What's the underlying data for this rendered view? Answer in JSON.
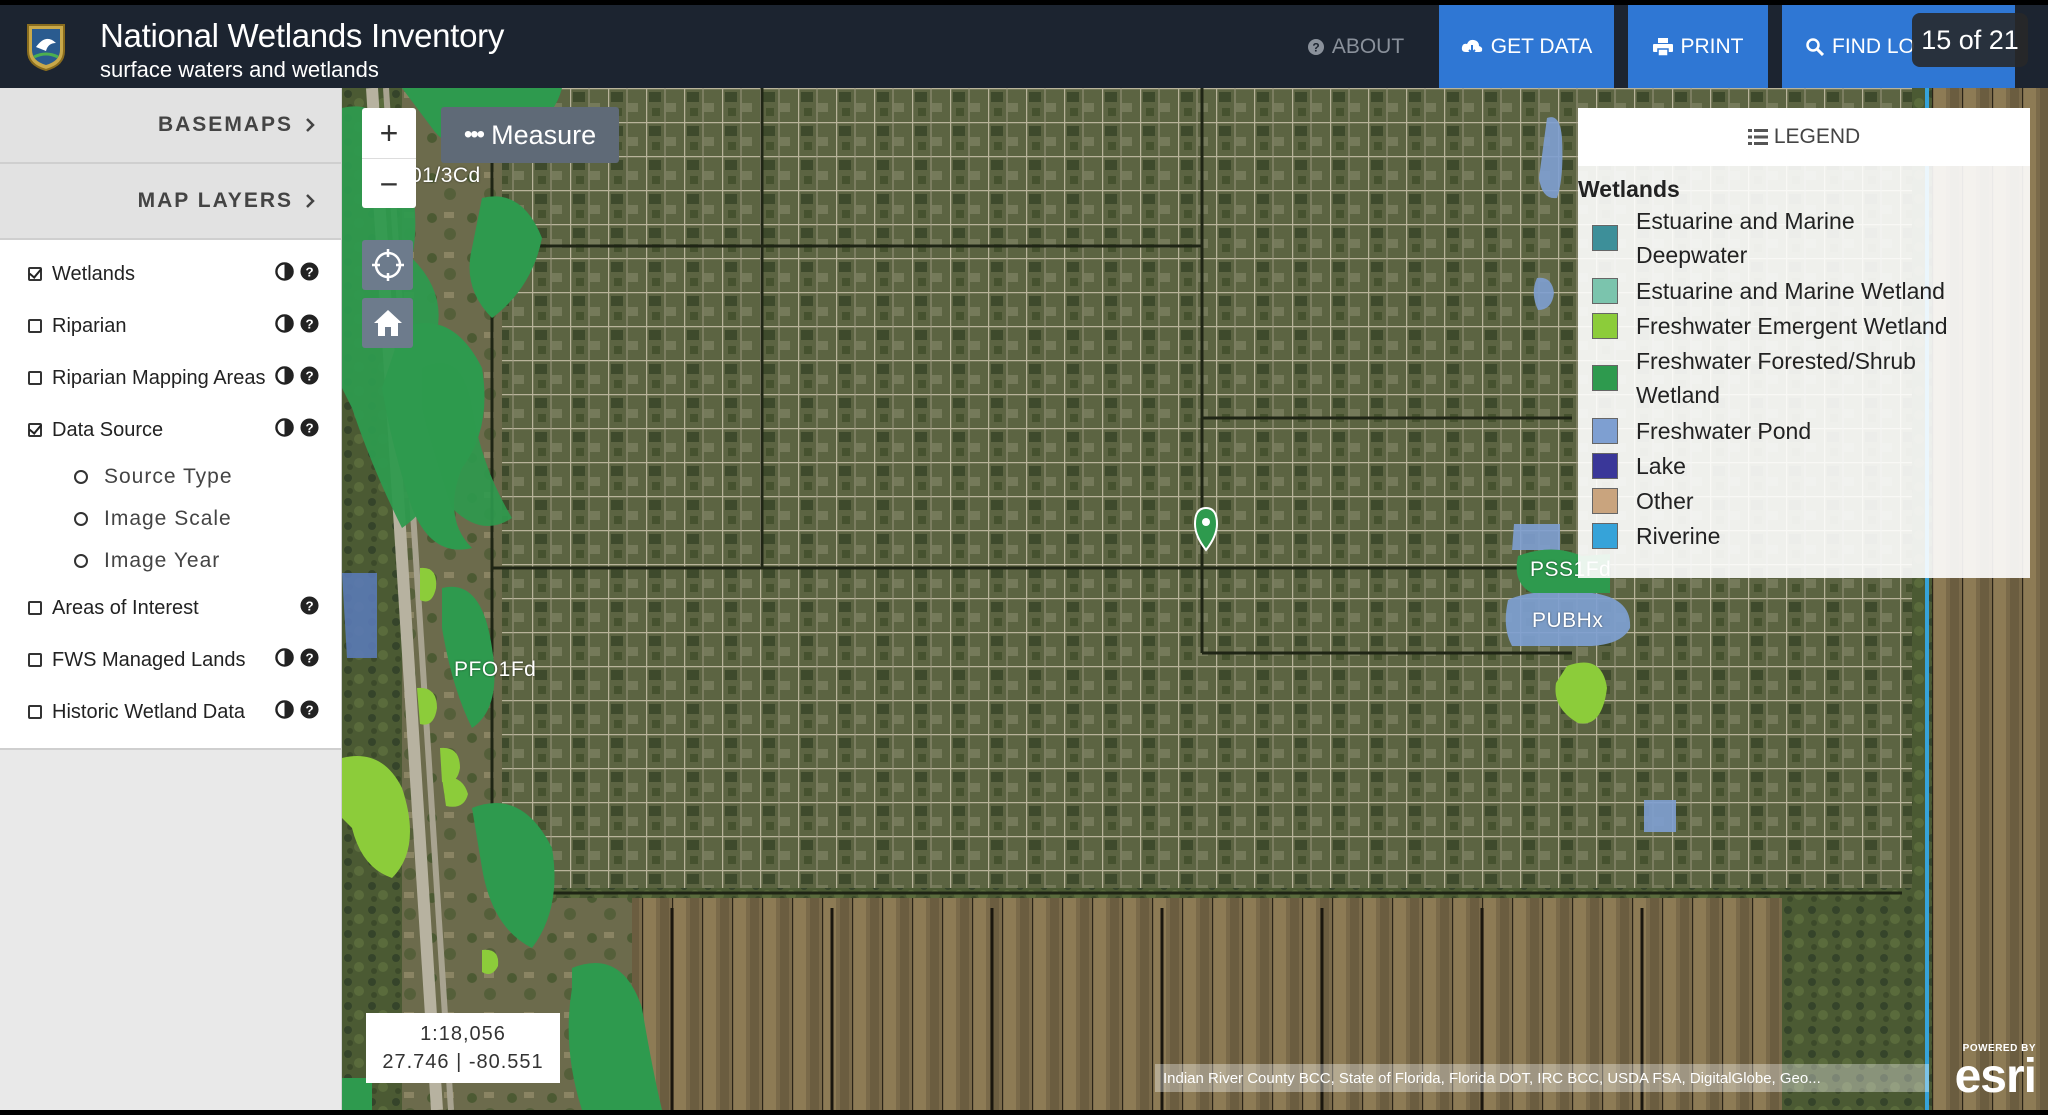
{
  "header": {
    "title": "National Wetlands Inventory",
    "subtitle": "surface waters and wetlands",
    "about_label": "ABOUT",
    "get_data_label": "GET DATA",
    "print_label": "PRINT",
    "find_location_label": "FIND LO"
  },
  "page_counter": "15 of 21",
  "sidebar": {
    "basemaps_label": "BASEMAPS",
    "map_layers_label": "MAP LAYERS",
    "layers": [
      {
        "label": "Wetlands",
        "checked": true
      },
      {
        "label": "Riparian",
        "checked": false
      },
      {
        "label": "Riparian Mapping Areas",
        "checked": false
      },
      {
        "label": "Data Source",
        "checked": true
      },
      {
        "label": "Areas of Interest",
        "checked": false
      },
      {
        "label": "FWS Managed Lands",
        "checked": false
      },
      {
        "label": "Historic Wetland Data",
        "checked": false
      }
    ],
    "data_source_options": [
      "Source Type",
      "Image Scale",
      "Image Year"
    ]
  },
  "map": {
    "measure_label": "Measure",
    "labels": {
      "top_left": "01/3Cd",
      "pfo": "PFO1Fd",
      "pss": "PSS1Fd",
      "pubhx": "PUBHx"
    },
    "scale": "1:18,056",
    "coordinates": "27.746 | -80.551",
    "attribution": "Indian River County BCC, State of Florida, Florida DOT, IRC BCC, USDA FSA, DigitalGlobe, Geo...",
    "esri_powered": "POWERED BY",
    "esri_name": "esri"
  },
  "legend": {
    "title": "LEGEND",
    "group": "Wetlands",
    "items": [
      {
        "label_1": "Estuarine and Marine",
        "label_2": "Deepwater",
        "color": "#3d8f99"
      },
      {
        "label_1": "Estuarine and Marine Wetland",
        "color": "#7bc4ad"
      },
      {
        "label_1": "Freshwater Emergent Wetland",
        "color": "#8ccc3a"
      },
      {
        "label_1": "Freshwater Forested/Shrub",
        "label_2": "Wetland",
        "color": "#2e9a4e"
      },
      {
        "label_1": "Freshwater Pond",
        "color": "#7e9fd1"
      },
      {
        "label_1": "Lake",
        "color": "#3a3799"
      },
      {
        "label_1": "Other",
        "color": "#c9a47e"
      },
      {
        "label_1": "Riverine",
        "color": "#36a3d9"
      }
    ]
  },
  "colors": {
    "header_bg": "#1c2430",
    "accent_blue": "#2f77d4",
    "forested": "#2e9a4e",
    "emergent": "#8ccc3a",
    "pond": "#7e9fd1"
  }
}
